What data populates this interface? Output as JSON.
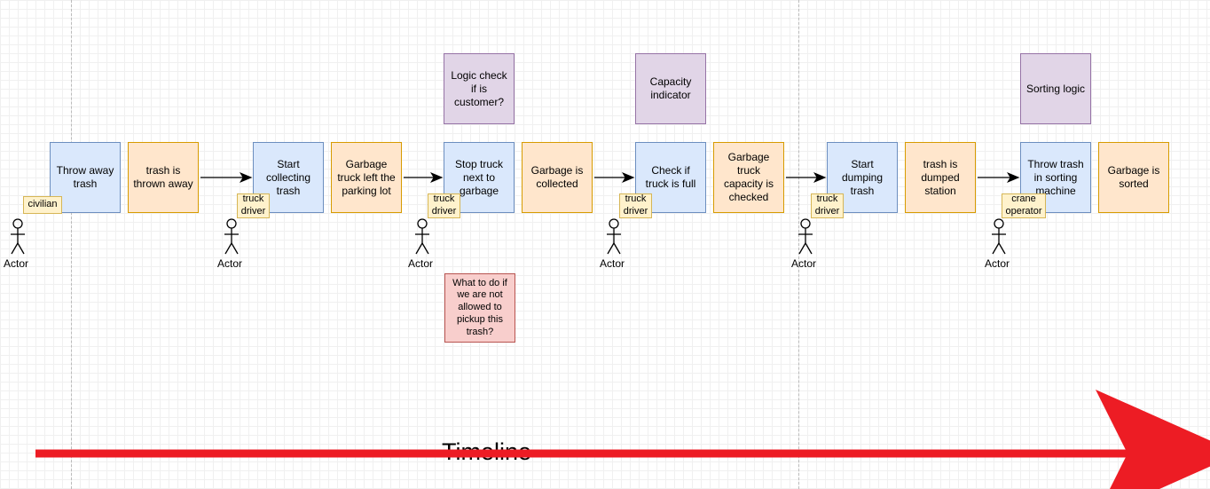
{
  "timeline_label": "Timeline",
  "actor_label": "Actor",
  "steps": [
    {
      "action": "Throw away trash",
      "result": "trash is thrown away",
      "role": "civilian"
    },
    {
      "action": "Start collecting trash",
      "result": "Garbage truck left the parking lot",
      "role": "truck driver"
    },
    {
      "action": "Stop truck next to garbage",
      "result": "Garbage is collected",
      "role": "truck driver",
      "logic": "Logic check if is customer?",
      "question": "What to do if we are not allowed to pickup this trash?"
    },
    {
      "action": "Check if truck is full",
      "result": "Garbage truck capacity is checked",
      "role": "truck driver",
      "logic": "Capacity indicator"
    },
    {
      "action": "Start dumping trash",
      "result": "trash is dumped station",
      "role": "truck driver"
    },
    {
      "action": "Throw trash in sorting machine",
      "result": "Garbage is sorted",
      "role": "crane operator",
      "logic": "Sorting logic"
    }
  ]
}
